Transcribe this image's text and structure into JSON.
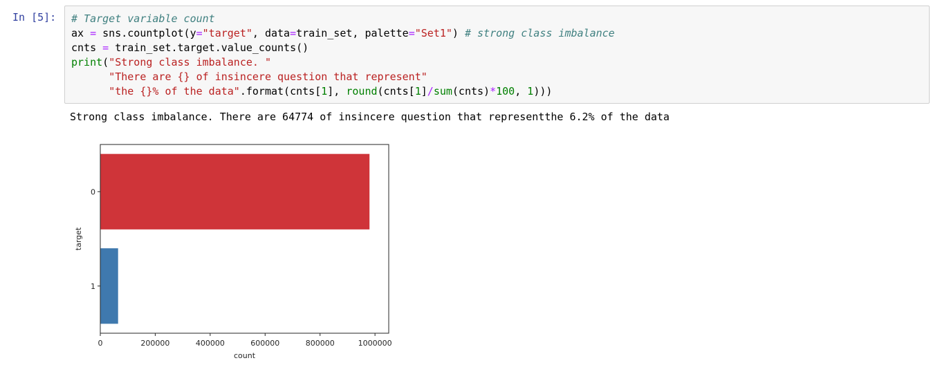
{
  "cell": {
    "prompt": "In [5]:",
    "code_lines": [
      [
        {
          "t": "# Target variable count",
          "c": "comment"
        }
      ],
      [
        {
          "t": "ax ",
          "c": "plain"
        },
        {
          "t": "=",
          "c": "op"
        },
        {
          "t": " sns.countplot(y",
          "c": "plain"
        },
        {
          "t": "=",
          "c": "op"
        },
        {
          "t": "\"target\"",
          "c": "str"
        },
        {
          "t": ", data",
          "c": "plain"
        },
        {
          "t": "=",
          "c": "op"
        },
        {
          "t": "train_set, palette",
          "c": "plain"
        },
        {
          "t": "=",
          "c": "op"
        },
        {
          "t": "\"Set1\"",
          "c": "str"
        },
        {
          "t": ") ",
          "c": "plain"
        },
        {
          "t": "# strong class imbalance",
          "c": "comment"
        }
      ],
      [
        {
          "t": "cnts ",
          "c": "plain"
        },
        {
          "t": "=",
          "c": "op"
        },
        {
          "t": " train_set.target.value_counts()",
          "c": "plain"
        }
      ],
      [
        {
          "t": "print",
          "c": "builtin"
        },
        {
          "t": "(",
          "c": "plain"
        },
        {
          "t": "\"Strong class imbalance. \"",
          "c": "str"
        }
      ],
      [
        {
          "t": "      ",
          "c": "plain"
        },
        {
          "t": "\"There are {} of insincere question that represent\"",
          "c": "str"
        }
      ],
      [
        {
          "t": "      ",
          "c": "plain"
        },
        {
          "t": "\"the {}% of the data\"",
          "c": "str"
        },
        {
          "t": ".format(cnts[",
          "c": "plain"
        },
        {
          "t": "1",
          "c": "num"
        },
        {
          "t": "], ",
          "c": "plain"
        },
        {
          "t": "round",
          "c": "builtin"
        },
        {
          "t": "(cnts[",
          "c": "plain"
        },
        {
          "t": "1",
          "c": "num"
        },
        {
          "t": "]",
          "c": "plain"
        },
        {
          "t": "/",
          "c": "op"
        },
        {
          "t": "sum",
          "c": "builtin"
        },
        {
          "t": "(cnts)",
          "c": "plain"
        },
        {
          "t": "*",
          "c": "op"
        },
        {
          "t": "100",
          "c": "num"
        },
        {
          "t": ", ",
          "c": "plain"
        },
        {
          "t": "1",
          "c": "num"
        },
        {
          "t": ")))",
          "c": "plain"
        }
      ]
    ],
    "output_text": "Strong class imbalance. There are 64774 of insincere question that representthe 6.2% of the data"
  },
  "colors": {
    "bar_0": "#cf3439",
    "bar_1": "#3f79ae"
  },
  "chart_data": {
    "type": "bar",
    "orientation": "horizontal",
    "categories": [
      "0",
      "1"
    ],
    "values": [
      980000,
      64774
    ],
    "xlabel": "count",
    "ylabel": "target",
    "xlim": [
      0,
      1050000
    ],
    "xticks": [
      0,
      200000,
      400000,
      600000,
      800000,
      1000000
    ],
    "xtick_labels": [
      "0",
      "200000",
      "400000",
      "600000",
      "800000",
      "1000000"
    ],
    "grid": false
  }
}
